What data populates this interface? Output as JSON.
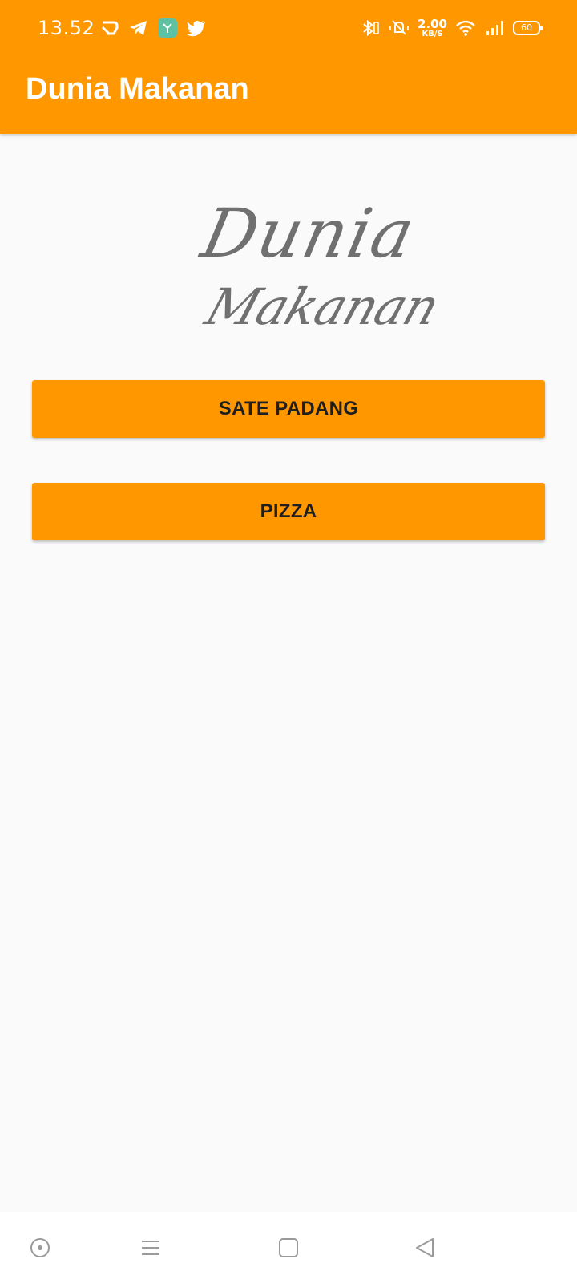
{
  "status_bar": {
    "time": "13.52",
    "net_speed_value": "2.00",
    "net_speed_unit": "KB/S",
    "battery": "60",
    "left_icons": [
      "cast-icon",
      "telegram-icon",
      "app-icon",
      "twitter-icon"
    ],
    "right_icons": [
      "bluetooth-icon",
      "silent-icon",
      "wifi-icon",
      "signal-icon"
    ]
  },
  "app_bar": {
    "title": "Dunia Makanan"
  },
  "logo": {
    "line1": "Dunia",
    "line2": "Makanan"
  },
  "buttons": {
    "sate": "SATE PADANG",
    "pizza": "PIZZA"
  },
  "nav": [
    "home-circle-icon",
    "menu-icon",
    "square-icon",
    "back-icon"
  ],
  "colors": {
    "primary": "#ff9800",
    "logo_text": "#707070",
    "background": "#fafafa"
  }
}
